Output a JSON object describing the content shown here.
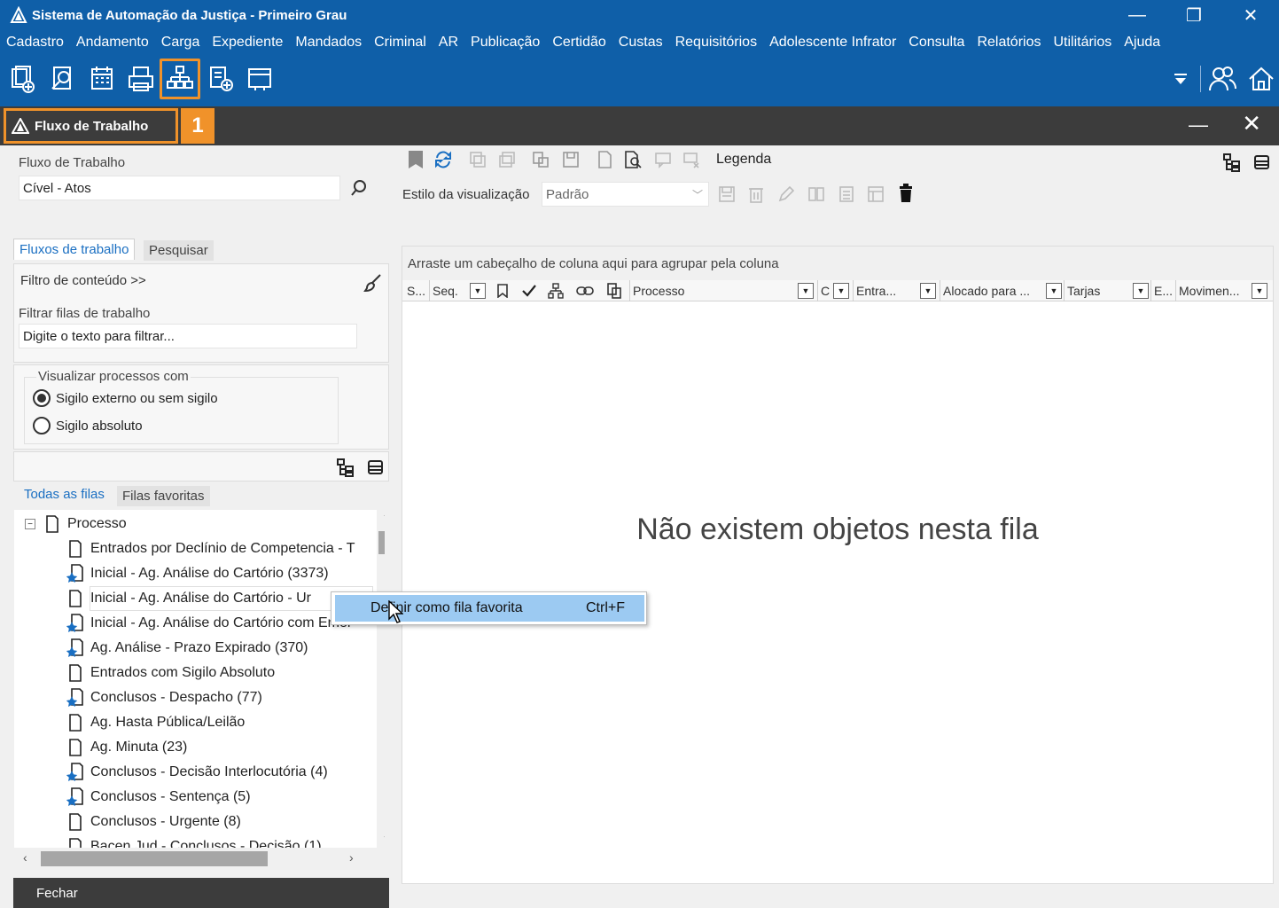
{
  "window": {
    "title": "Sistema de Automação da Justiça - Primeiro Grau",
    "minimize": "—",
    "restore": "❐",
    "close": "✕"
  },
  "menu": [
    "Cadastro",
    "Andamento",
    "Carga",
    "Expediente",
    "Mandados",
    "Criminal",
    "AR",
    "Publicação",
    "Certidão",
    "Custas",
    "Requisitórios",
    "Adolescente Infrator",
    "Consulta",
    "Relatórios",
    "Utilitários",
    "Ajuda"
  ],
  "subwindow": {
    "title": "Fluxo de Trabalho",
    "badge": "1",
    "minimize": "—",
    "close": "✕"
  },
  "left": {
    "flow_label": "Fluxo de Trabalho",
    "flow_value": "Cível - Atos",
    "tabs": [
      "Fluxos de trabalho",
      "Pesquisar"
    ],
    "content_filter": "Filtro de conteúdo >>",
    "filter_queues_label": "Filtrar filas de trabalho",
    "filter_placeholder": "Digite o texto para filtrar...",
    "visualize_label": "Visualizar processos com",
    "radio_external": "Sigilo externo ou sem sigilo",
    "radio_absolute": "Sigilo absoluto",
    "queue_tabs": [
      "Todas as filas",
      "Filas favoritas"
    ],
    "tree_root": "Processo",
    "tree_items": [
      {
        "label": "Entrados por Declínio de Competencia - T",
        "starred": false
      },
      {
        "label": "Inicial - Ag. Análise do Cartório (3373)",
        "starred": true
      },
      {
        "label": "Inicial - Ag. Análise do Cartório - Ur",
        "starred": false
      },
      {
        "label": "Inicial - Ag. Análise do Cartório com Emer",
        "starred": true
      },
      {
        "label": "Ag. Análise - Prazo Expirado (370)",
        "starred": true
      },
      {
        "label": "Entrados com Sigilo Absoluto",
        "starred": false
      },
      {
        "label": "Conclusos - Despacho (77)",
        "starred": true
      },
      {
        "label": "Ag. Hasta Pública/Leilão",
        "starred": false
      },
      {
        "label": "Ag. Minuta (23)",
        "starred": false
      },
      {
        "label": "Conclusos - Decisão Interlocutória (4)",
        "starred": true
      },
      {
        "label": "Conclusos - Sentença (5)",
        "starred": true
      },
      {
        "label": "Conclusos - Urgente (8)",
        "starred": false
      },
      {
        "label": "Bacen Jud - Conclusos - Decisão (1)",
        "starred": false
      }
    ],
    "close_button": "Fechar"
  },
  "right": {
    "legend": "Legenda",
    "view_style_label": "Estilo da visualização",
    "view_style_value": "Padrão",
    "group_hint": "Arraste um cabeçalho de coluna aqui para agrupar pela coluna",
    "columns": [
      "S...",
      "Seq.",
      "Processo",
      "C",
      "Entra...",
      "Alocado para ...",
      "Tarjas",
      "E...",
      "Movimen..."
    ],
    "empty_message": "Não existem objetos nesta fila"
  },
  "context_menu": {
    "item_label": "Definir como fila favorita",
    "shortcut": "Ctrl+F"
  },
  "colors": {
    "brand": "#0f5fa8",
    "highlight": "#f0922a",
    "dark_bar": "#3c3c3c"
  }
}
